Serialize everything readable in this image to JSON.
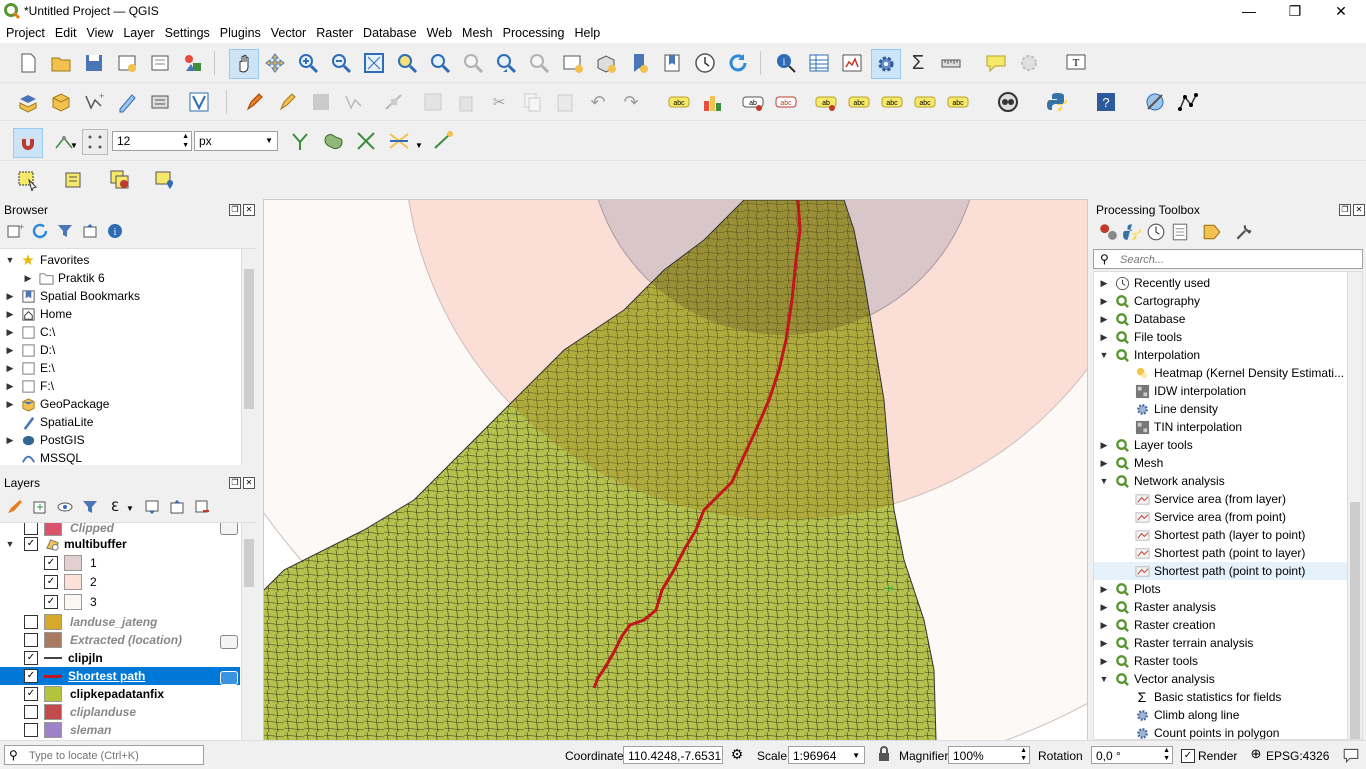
{
  "window": {
    "title": "*Untitled Project — QGIS",
    "minimize": "—",
    "maximize": "❐",
    "close": "✕"
  },
  "menu": [
    "Project",
    "Edit",
    "View",
    "Layer",
    "Settings",
    "Plugins",
    "Vector",
    "Raster",
    "Database",
    "Web",
    "Mesh",
    "Processing",
    "Help"
  ],
  "snapping": {
    "tolerance": "12",
    "unit": "px"
  },
  "browser": {
    "title": "Browser",
    "items": [
      {
        "label": "Favorites",
        "icon": "star-icon",
        "expanded": true
      },
      {
        "label": "Praktik 6",
        "icon": "folder-icon"
      },
      {
        "label": "Spatial Bookmarks",
        "icon": "bookmark-icon"
      },
      {
        "label": "Home",
        "icon": "home-icon"
      },
      {
        "label": "C:\\",
        "icon": "drive-icon"
      },
      {
        "label": "D:\\",
        "icon": "drive-icon"
      },
      {
        "label": "E:\\",
        "icon": "drive-icon"
      },
      {
        "label": "F:\\",
        "icon": "drive-icon"
      },
      {
        "label": "GeoPackage",
        "icon": "geopackage-icon"
      },
      {
        "label": "SpatiaLite",
        "icon": "spatialite-icon"
      },
      {
        "label": "PostGIS",
        "icon": "postgis-icon"
      },
      {
        "label": "MSSQL",
        "icon": "mssql-icon"
      }
    ]
  },
  "layers": {
    "title": "Layers",
    "items": [
      {
        "label": "Clipped",
        "checked": false,
        "style": "italic",
        "swatch": "#d9536d"
      },
      {
        "label": "multibuffer",
        "checked": true,
        "style": "bold",
        "swatch": ""
      },
      {
        "label": "1",
        "checked": true,
        "style": "normal",
        "swatch": "#e3cfd1"
      },
      {
        "label": "2",
        "checked": true,
        "style": "normal",
        "swatch": "#fde0d8"
      },
      {
        "label": "3",
        "checked": true,
        "style": "normal",
        "swatch": "#fdf6f3"
      },
      {
        "label": "landuse_jateng",
        "checked": false,
        "style": "italic",
        "swatch": "#d8a82b"
      },
      {
        "label": "Extracted (location)",
        "checked": false,
        "style": "italic",
        "swatch": "#a87b5e"
      },
      {
        "label": "clipjln",
        "checked": true,
        "style": "bold",
        "swatch": "line"
      },
      {
        "label": "Shortest path",
        "checked": true,
        "style": "selected",
        "swatch": "redline"
      },
      {
        "label": "clipkepadatanfix",
        "checked": true,
        "style": "bold",
        "swatch": "#b5c23b"
      },
      {
        "label": "cliplanduse",
        "checked": false,
        "style": "italic",
        "swatch": "#c44b4b"
      },
      {
        "label": "sleman",
        "checked": false,
        "style": "italic",
        "swatch": "#9d82c9"
      }
    ]
  },
  "toolbox": {
    "title": "Processing Toolbox",
    "search_placeholder": "Search...",
    "items": [
      {
        "label": "Recently used",
        "level": 0,
        "arrow": "▶",
        "icon": "clock-icon"
      },
      {
        "label": "Cartography",
        "level": 0,
        "arrow": "▶",
        "icon": "qgis-icon"
      },
      {
        "label": "Database",
        "level": 0,
        "arrow": "▶",
        "icon": "qgis-icon"
      },
      {
        "label": "File tools",
        "level": 0,
        "arrow": "▶",
        "icon": "qgis-icon"
      },
      {
        "label": "Interpolation",
        "level": 0,
        "arrow": "▼",
        "icon": "qgis-icon"
      },
      {
        "label": "Heatmap (Kernel Density Estimati...",
        "level": 1,
        "arrow": "",
        "icon": "heatmap-icon"
      },
      {
        "label": "IDW interpolation",
        "level": 1,
        "arrow": "",
        "icon": "grid-icon"
      },
      {
        "label": "Line density",
        "level": 1,
        "arrow": "",
        "icon": "gear-icon"
      },
      {
        "label": "TIN interpolation",
        "level": 1,
        "arrow": "",
        "icon": "grid-icon"
      },
      {
        "label": "Layer tools",
        "level": 0,
        "arrow": "▶",
        "icon": "qgis-icon"
      },
      {
        "label": "Mesh",
        "level": 0,
        "arrow": "▶",
        "icon": "qgis-icon"
      },
      {
        "label": "Network analysis",
        "level": 0,
        "arrow": "▼",
        "icon": "qgis-icon"
      },
      {
        "label": "Service area (from layer)",
        "level": 1,
        "arrow": "",
        "icon": "network-icon"
      },
      {
        "label": "Service area (from point)",
        "level": 1,
        "arrow": "",
        "icon": "network-icon"
      },
      {
        "label": "Shortest path (layer to point)",
        "level": 1,
        "arrow": "",
        "icon": "network-icon"
      },
      {
        "label": "Shortest path (point to layer)",
        "level": 1,
        "arrow": "",
        "icon": "network-icon"
      },
      {
        "label": "Shortest path (point to point)",
        "level": 1,
        "arrow": "",
        "icon": "network-icon",
        "selected": true
      },
      {
        "label": "Plots",
        "level": 0,
        "arrow": "▶",
        "icon": "qgis-icon"
      },
      {
        "label": "Raster analysis",
        "level": 0,
        "arrow": "▶",
        "icon": "qgis-icon"
      },
      {
        "label": "Raster creation",
        "level": 0,
        "arrow": "▶",
        "icon": "qgis-icon"
      },
      {
        "label": "Raster terrain analysis",
        "level": 0,
        "arrow": "▶",
        "icon": "qgis-icon"
      },
      {
        "label": "Raster tools",
        "level": 0,
        "arrow": "▶",
        "icon": "qgis-icon"
      },
      {
        "label": "Vector analysis",
        "level": 0,
        "arrow": "▼",
        "icon": "qgis-icon"
      },
      {
        "label": "Basic statistics for fields",
        "level": 1,
        "arrow": "",
        "icon": "sigma-icon"
      },
      {
        "label": "Climb along line",
        "level": 1,
        "arrow": "",
        "icon": "gear-icon"
      },
      {
        "label": "Count points in polygon",
        "level": 1,
        "arrow": "",
        "icon": "gear-icon"
      }
    ]
  },
  "statusbar": {
    "locate_placeholder": "Type to locate (Ctrl+K)",
    "coordinate_label": "Coordinate",
    "coordinate": "110.4248,-7.6531",
    "scale_label": "Scale",
    "scale": "1:96964",
    "magnifier_label": "Magnifier",
    "magnifier": "100%",
    "rotation_label": "Rotation",
    "rotation": "0,0 °",
    "render_label": "Render",
    "crs": "EPSG:4326"
  },
  "colors": {
    "selection": "#0078d7",
    "route": "#c0161c",
    "buffer1": "#d4c0c4",
    "buffer2": "#fbd9d1",
    "buffer3": "#fbf7f5",
    "density_low": "#b7c25c",
    "density_high": "#97892c"
  }
}
